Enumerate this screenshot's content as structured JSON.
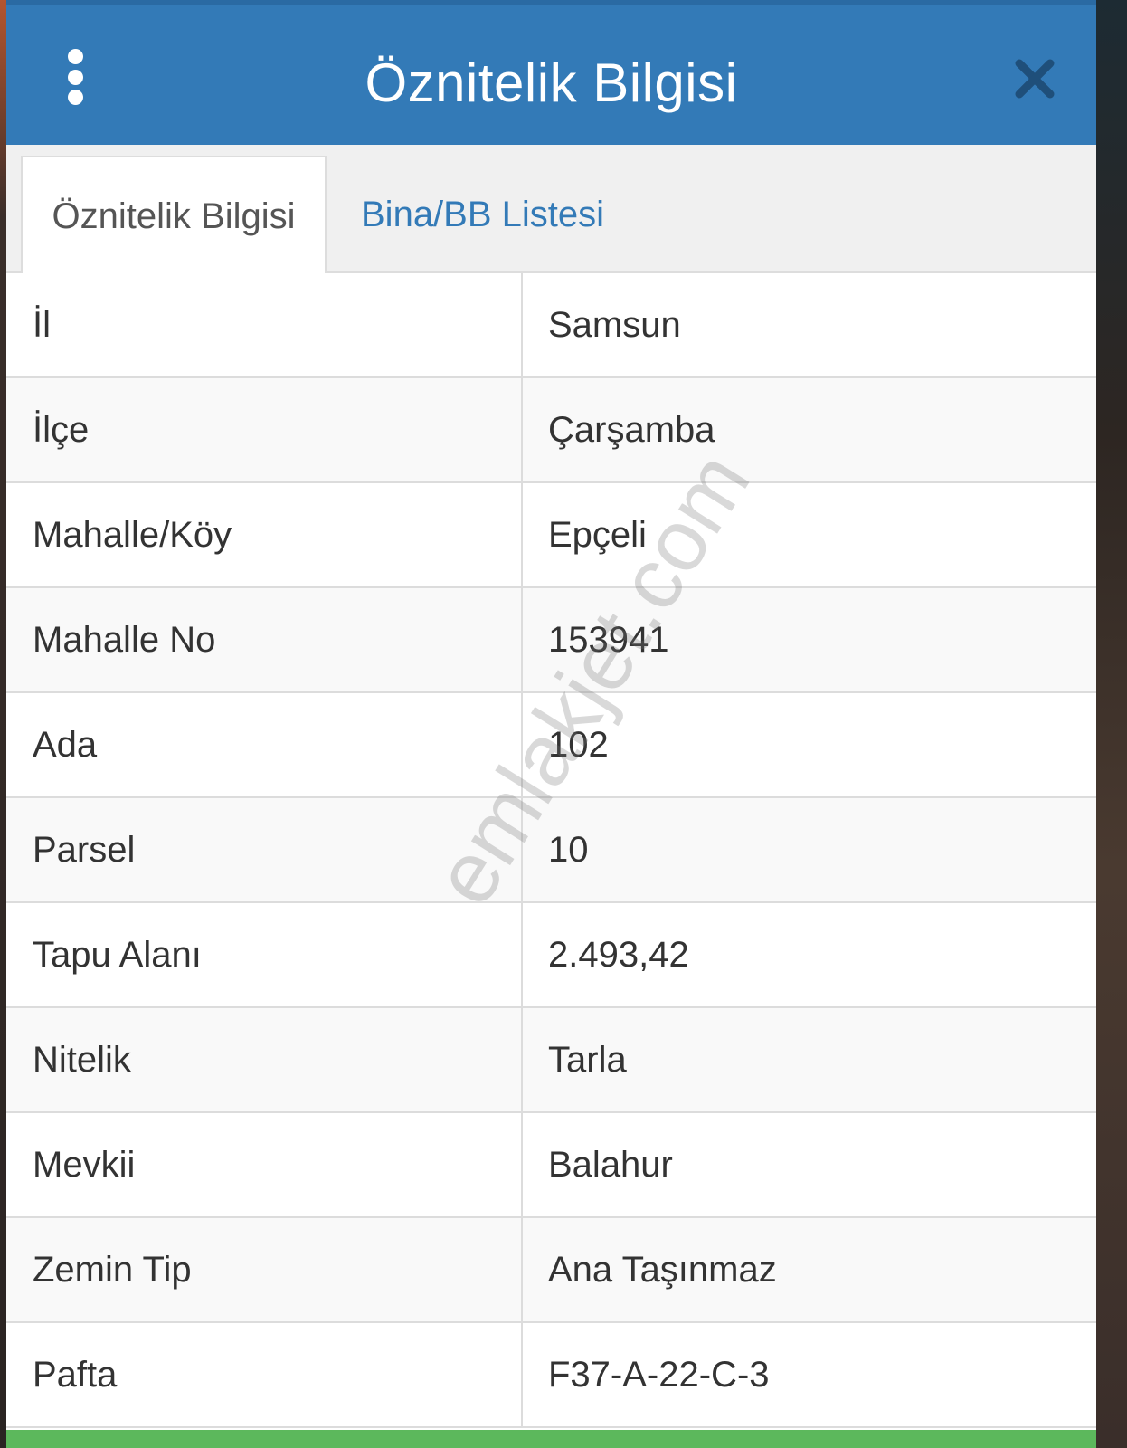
{
  "header": {
    "title": "Öznitelik Bilgisi",
    "menu_icon": "vertical-dots-icon",
    "close_icon": "close-icon"
  },
  "tabs": [
    {
      "label": "Öznitelik Bilgisi",
      "active": true
    },
    {
      "label": "Bina/BB Listesi",
      "active": false
    }
  ],
  "attributes": [
    {
      "key": "İl",
      "value": "Samsun"
    },
    {
      "key": "İlçe",
      "value": "Çarşamba"
    },
    {
      "key": "Mahalle/Köy",
      "value": "Epçeli"
    },
    {
      "key": "Mahalle No",
      "value": "153941"
    },
    {
      "key": "Ada",
      "value": "102"
    },
    {
      "key": "Parsel",
      "value": "10"
    },
    {
      "key": "Tapu Alanı",
      "value": "2.493,42"
    },
    {
      "key": "Nitelik",
      "value": "Tarla"
    },
    {
      "key": "Mevkii",
      "value": "Balahur"
    },
    {
      "key": "Zemin Tip",
      "value": "Ana Taşınmaz"
    },
    {
      "key": "Pafta",
      "value": "F37-A-22-C-3"
    }
  ],
  "watermark": "emlakjet.com",
  "colors": {
    "header": "#337ab7",
    "tab_link": "#337ab7",
    "footer": "#5cb85c"
  }
}
